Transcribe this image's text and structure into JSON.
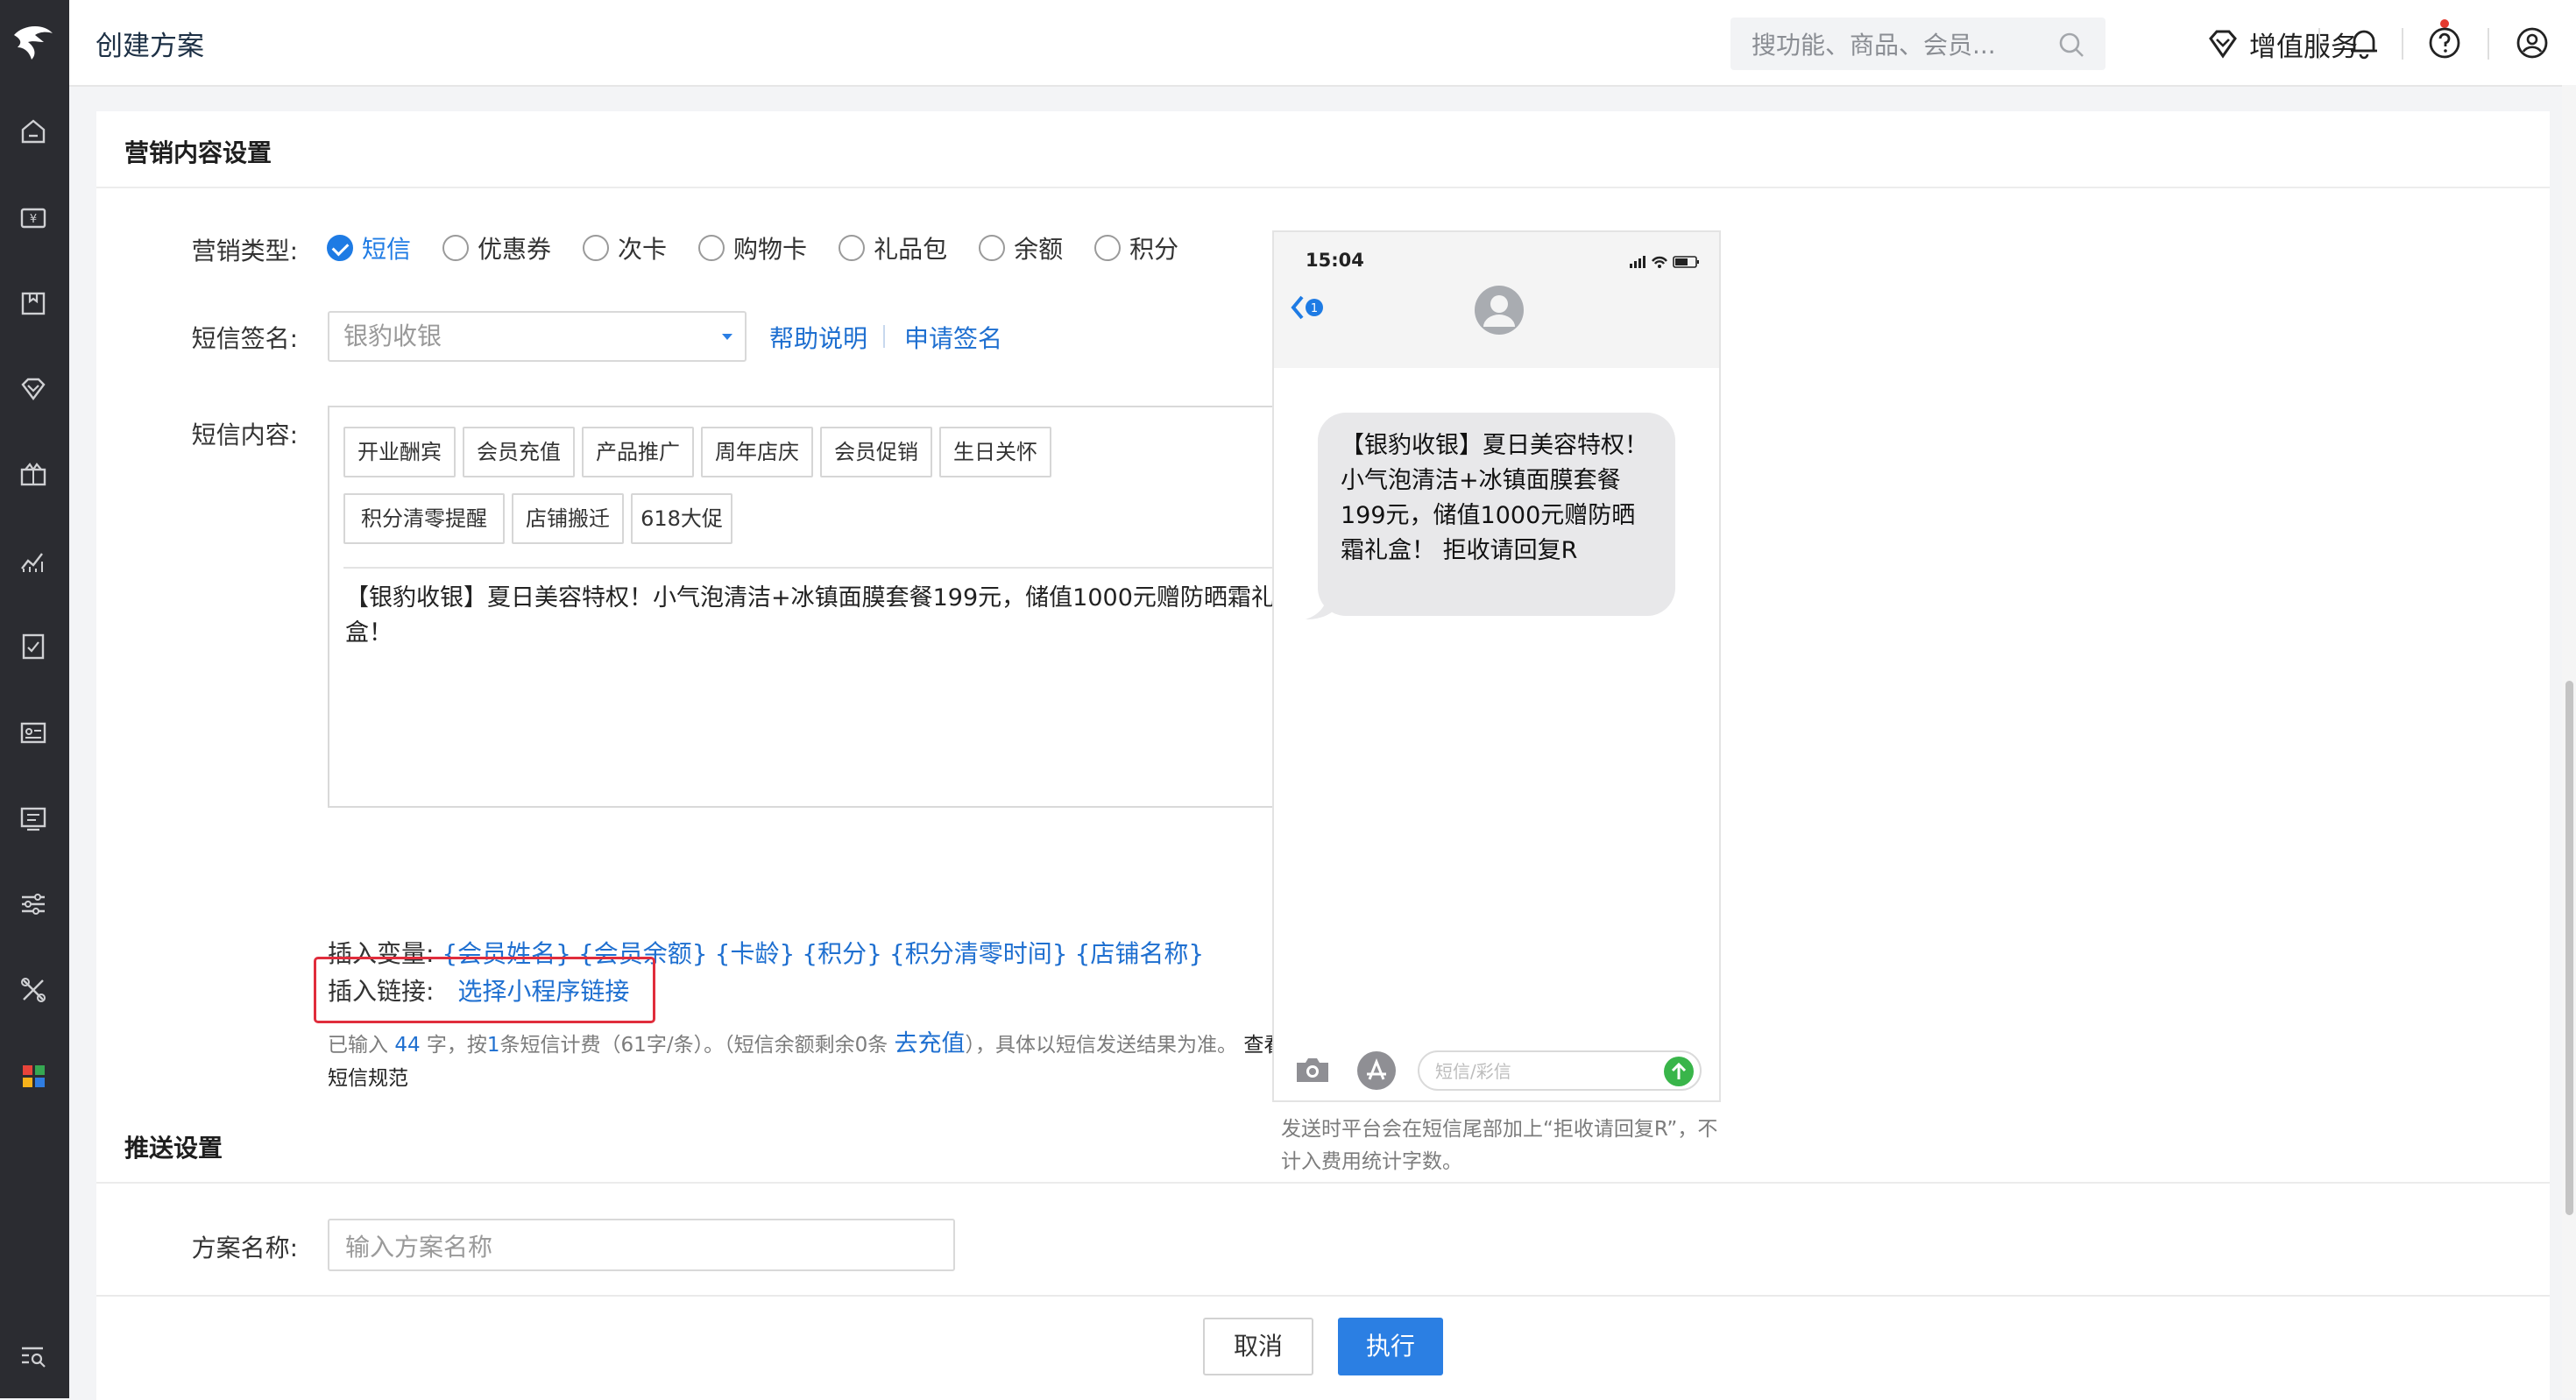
{
  "header": {
    "title": "创建方案",
    "search_placeholder": "搜功能、商品、会员...",
    "value_added_services": "增值服务"
  },
  "sections": {
    "marketing_content": "营销内容设置",
    "push_settings": "推送设置"
  },
  "marketing_type": {
    "label": "营销类型:",
    "selected": "短信",
    "options": [
      "短信",
      "优惠券",
      "次卡",
      "购物卡",
      "礼品包",
      "余额",
      "积分"
    ]
  },
  "signature": {
    "label": "短信签名:",
    "placeholder": "银豹收银",
    "help": "帮助说明",
    "apply": "申请签名"
  },
  "sms_content": {
    "label": "短信内容:",
    "templates": [
      "开业酬宾",
      "会员充值",
      "产品推广",
      "周年店庆",
      "会员促销",
      "生日关怀",
      "积分清零提醒",
      "店铺搬迁",
      "618大促"
    ],
    "text": "【银豹收银】夏日美容特权！小气泡清洁+冰镇面膜套餐199元，储值1000元赠防晒霜礼盒！"
  },
  "insert_variable": {
    "label": "插入变量:",
    "vars": [
      "{会员姓名}",
      "{会员余额}",
      "{卡龄}",
      "{积分}",
      "{积分清零时间}",
      "{店铺名称}"
    ]
  },
  "insert_link": {
    "label": "插入链接:",
    "action": "选择小程序链接"
  },
  "hint": {
    "p1": "已输入",
    "count": "44",
    "p2": "字，按",
    "sms_count": "1",
    "p3": "条短信计费（61字/条）。（短信余额剩余0条",
    "recharge": "去充值",
    "p4": "），具体以短信发送结果为准。",
    "rules": "查看短信规范"
  },
  "phone_preview": {
    "time": "15:04",
    "back_badge": "1",
    "message": "【银豹收银】夏日美容特权！小气泡清洁+冰镇面膜套餐199元，储值1000元赠防晒霜礼盒！ 拒收请回复R",
    "input_placeholder": "短信/彩信",
    "note": "发送时平台会在短信尾部加上“拒收请回复R”，不计入费用统计字数。"
  },
  "plan_name": {
    "label": "方案名称:",
    "placeholder": "输入方案名称"
  },
  "footer": {
    "cancel": "取消",
    "execute": "执行"
  },
  "colors": {
    "accent": "#1e7be4",
    "link": "#1e6fd0",
    "highlight_box": "#e02d3c",
    "rail": "#2b2c31"
  }
}
